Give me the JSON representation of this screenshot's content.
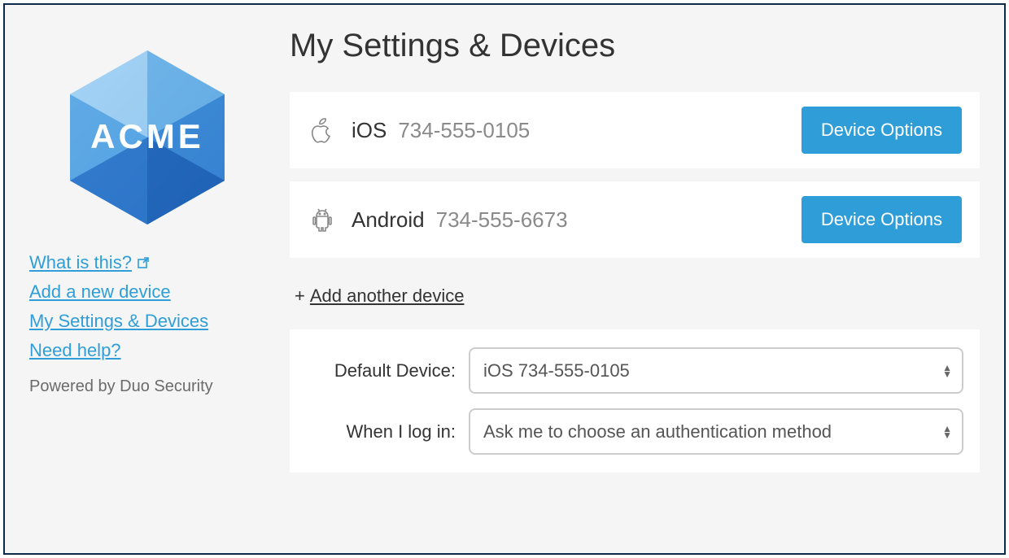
{
  "brand": "ACME",
  "sidebar": {
    "links": [
      {
        "label": "What is this?"
      },
      {
        "label": "Add a new device"
      },
      {
        "label": "My Settings & Devices"
      },
      {
        "label": "Need help?"
      }
    ],
    "powered": "Powered by Duo Security"
  },
  "main": {
    "title": "My Settings & Devices",
    "devices": [
      {
        "platform": "iOS",
        "phone": "734-555-0105",
        "button": "Device Options"
      },
      {
        "platform": "Android",
        "phone": "734-555-6673",
        "button": "Device Options"
      }
    ],
    "add_another_prefix": "+",
    "add_another_label": "Add another device",
    "settings": {
      "default_device_label": "Default Device:",
      "default_device_value": "iOS 734-555-0105",
      "login_label": "When I log in:",
      "login_value": "Ask me to choose an authentication method"
    }
  }
}
